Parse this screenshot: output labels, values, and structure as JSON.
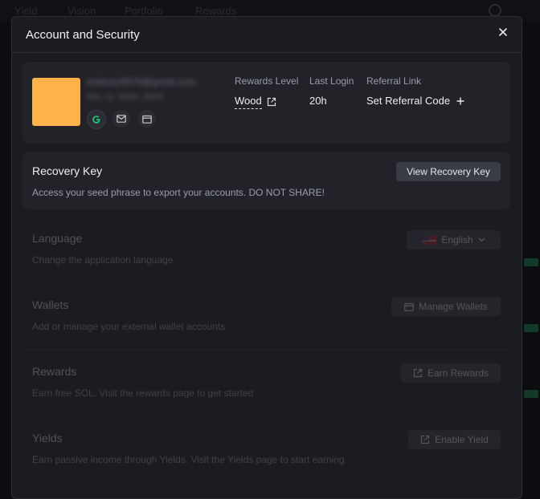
{
  "background": {
    "nav_items": [
      "Yield",
      "Vision",
      "Portfolio",
      "Rewards"
    ]
  },
  "modal": {
    "title": "Account and Security",
    "profile": {
      "email": "mabvey5978@gmail.com",
      "joined": "Dec 11 '2024, 2024",
      "stats": [
        {
          "label": "Rewards Level",
          "value": "Wood"
        },
        {
          "label": "Last Login",
          "value": "20h"
        },
        {
          "label": "Referral Link",
          "value": "Set Referral Code"
        }
      ]
    },
    "recovery": {
      "title": "Recovery Key",
      "description": "Access your seed phrase to export your accounts. DO NOT SHARE!",
      "button": "View Recovery Key"
    },
    "sections": [
      {
        "title": "Language",
        "description": "Change the application language",
        "button": "English"
      },
      {
        "title": "Wallets",
        "description": "Add or manage your external wallet accounts",
        "button": "Manage Wallets"
      },
      {
        "title": "Rewards",
        "description": "Earn free SOL. Visit the rewards page to get started",
        "button": "Earn Rewards"
      },
      {
        "title": "Yields",
        "description": "Earn passive income through Yields. Visit the Yields page to start earning",
        "button": "Enable Yield"
      }
    ]
  },
  "colors": {
    "avatar": "#ffb14a",
    "google_green": "#1fc37a"
  }
}
